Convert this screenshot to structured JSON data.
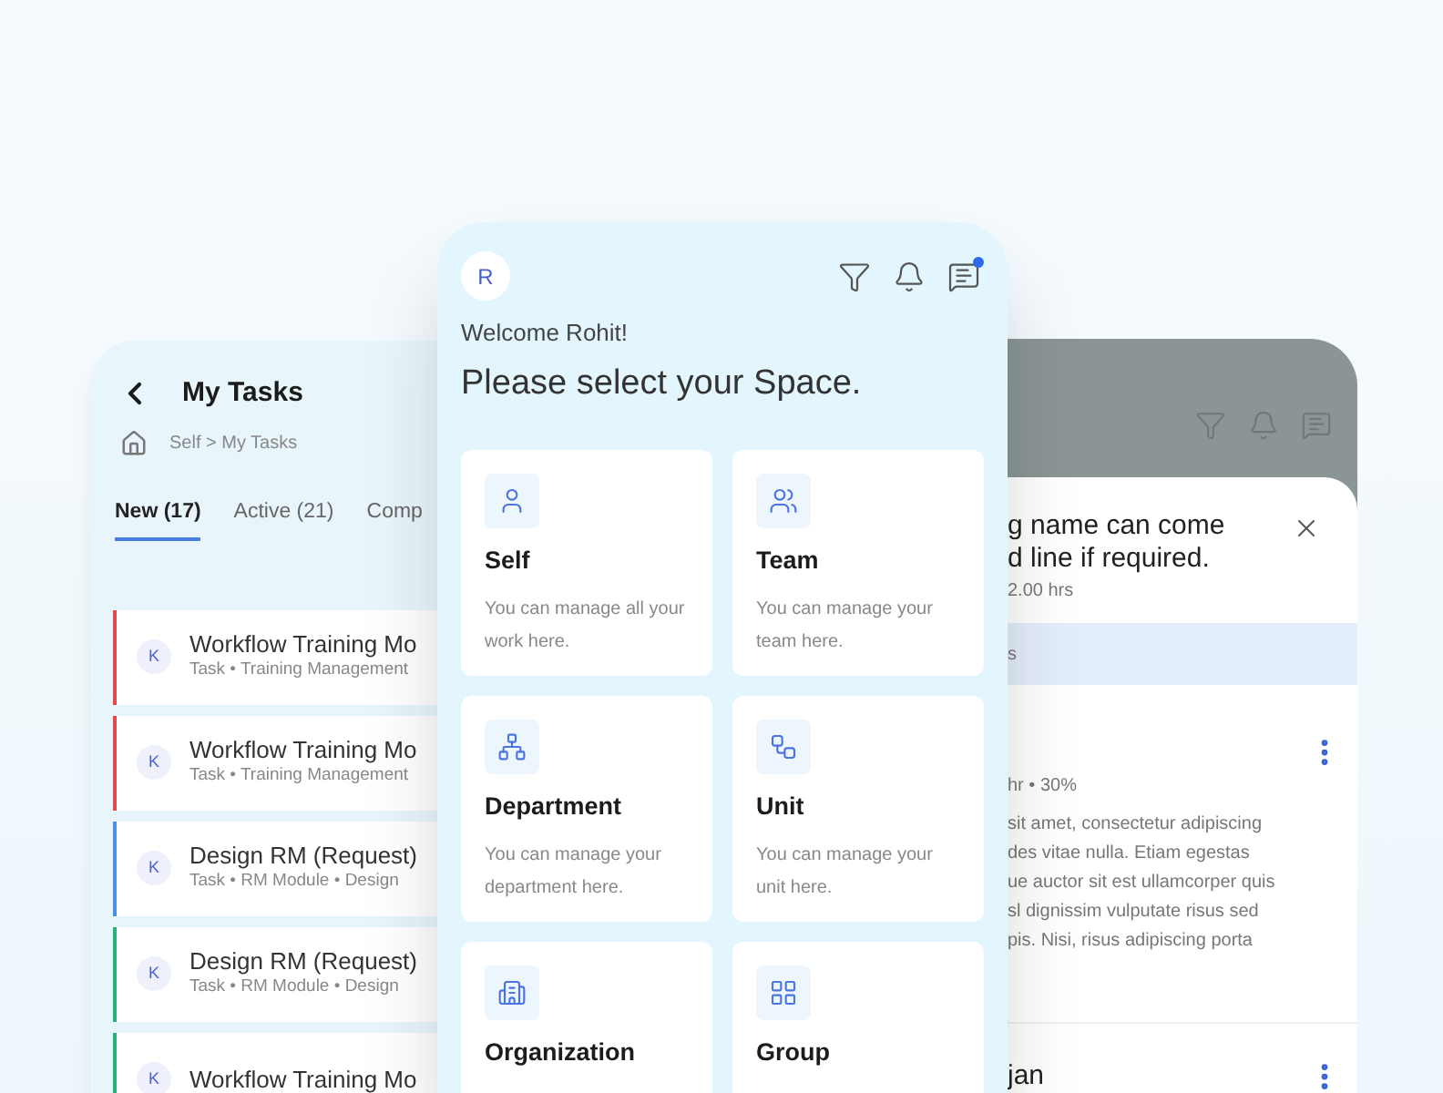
{
  "tasks_screen": {
    "title": "My Tasks",
    "breadcrumb": "Self > My Tasks",
    "tabs": [
      {
        "label": "New (17)",
        "selected": true
      },
      {
        "label": "Active (21)",
        "selected": false
      },
      {
        "label": "Comp",
        "selected": false
      }
    ],
    "tasks": [
      {
        "avatar": "K",
        "title": "Workflow Training Mo",
        "subtitle": "Task • Training Management",
        "color": "#e5484d"
      },
      {
        "avatar": "K",
        "title": "Workflow Training Mo",
        "subtitle": "Task • Training Management",
        "color": "#e5484d"
      },
      {
        "avatar": "K",
        "title": "Design RM (Request)",
        "subtitle": "Task • RM Module • Design",
        "color": "#4a8fe7"
      },
      {
        "avatar": "K",
        "title": "Design RM (Request)",
        "subtitle": "Task • RM Module • Design",
        "color": "#27b17a"
      },
      {
        "avatar": "K",
        "title": "Workflow Training Mo",
        "color": "#27b17a"
      }
    ]
  },
  "space_screen": {
    "avatar": "R",
    "messages_unread": true,
    "welcome": "Welcome Rohit!",
    "heading": "Please select your Space.",
    "spaces": [
      {
        "kind": "person",
        "title": "Self",
        "description": "You can manage all your work here."
      },
      {
        "kind": "people",
        "title": "Team",
        "description": "You can manage your team here."
      },
      {
        "kind": "hierarchy",
        "title": "Department",
        "description": "You can manage your department here."
      },
      {
        "kind": "nodes",
        "title": "Unit",
        "description": "You can manage your unit here."
      },
      {
        "kind": "building",
        "title": "Organization"
      },
      {
        "kind": "grid",
        "title": "Group"
      }
    ]
  },
  "detail_screen": {
    "title_lines": [
      "g name can come",
      "d line if required."
    ],
    "duration": "2.00 hrs",
    "band": "s",
    "meta": "hr • 30%",
    "body_lines": [
      "sit amet, consectetur adipiscing",
      "des vitae nulla. Etiam egestas",
      "ue auctor sit est ullamcorper quis",
      "sl dignissim vulputate risus sed",
      "pis. Nisi, risus adipiscing porta"
    ],
    "next_item": "jan"
  }
}
